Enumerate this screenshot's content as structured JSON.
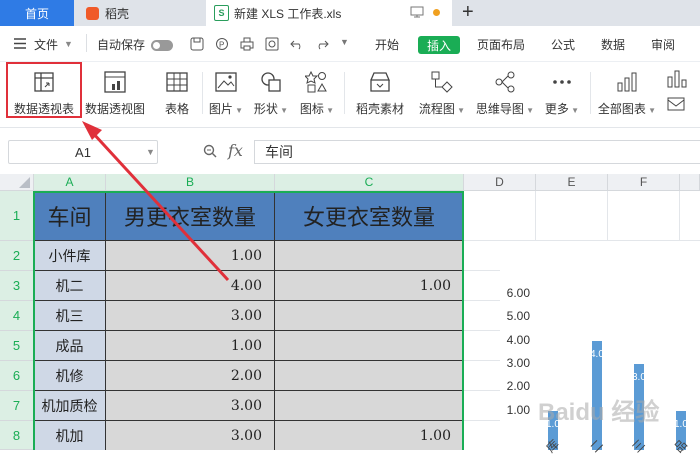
{
  "tabs": {
    "home": "首页",
    "daoke": "稻壳",
    "doc": "新建 XLS 工作表.xls",
    "add": "+"
  },
  "menu": {
    "file": "文件",
    "autosave": "自动保存",
    "items": [
      "开始",
      "插入",
      "页面布局",
      "公式",
      "数据",
      "审阅"
    ]
  },
  "ribbon": {
    "pivot_table": "数据透视表",
    "pivot_chart": "数据透视图",
    "table": "表格",
    "picture": "图片",
    "shape": "形状",
    "icon": "图标",
    "daoke_material": "稻壳素材",
    "flowchart": "流程图",
    "mindmap": "思维导图",
    "more": "更多",
    "all_charts": "全部图表"
  },
  "formula_bar": {
    "cell_ref": "A1",
    "fx": "fx",
    "content": "车间"
  },
  "columns": [
    "A",
    "B",
    "C",
    "D",
    "E",
    "F"
  ],
  "rows": [
    "1",
    "2",
    "3",
    "4",
    "5",
    "6",
    "7",
    "8"
  ],
  "table": {
    "headers": [
      "车间",
      "男更衣室数量",
      "女更衣室数量"
    ],
    "data": [
      [
        "小件库",
        "1.00",
        ""
      ],
      [
        "机二",
        "4.00",
        "1.00"
      ],
      [
        "机三",
        "3.00",
        ""
      ],
      [
        "成品",
        "1.00",
        ""
      ],
      [
        "机修",
        "2.00",
        ""
      ],
      [
        "机加质检",
        "3.00",
        ""
      ],
      [
        "机加",
        "3.00",
        "1.00"
      ]
    ]
  },
  "chart_data": {
    "type": "bar",
    "y_ticks": [
      "6.00",
      "5.00",
      "4.00",
      "3.00",
      "2.00",
      "1.00"
    ],
    "ylim": [
      0,
      6
    ],
    "visible_values": [
      1,
      4,
      3,
      1
    ],
    "visible_labels": [
      "1.0",
      "4.0",
      "3.0",
      "1.0"
    ],
    "x_labels_partial": [
      "库",
      "二",
      "三",
      "品"
    ]
  },
  "watermark": "Baidu 经验",
  "colors": {
    "accent_green": "#1aad55",
    "header_blue": "#4f80bd",
    "home_tab": "#2f7be5",
    "highlight_red": "#e0303a"
  }
}
